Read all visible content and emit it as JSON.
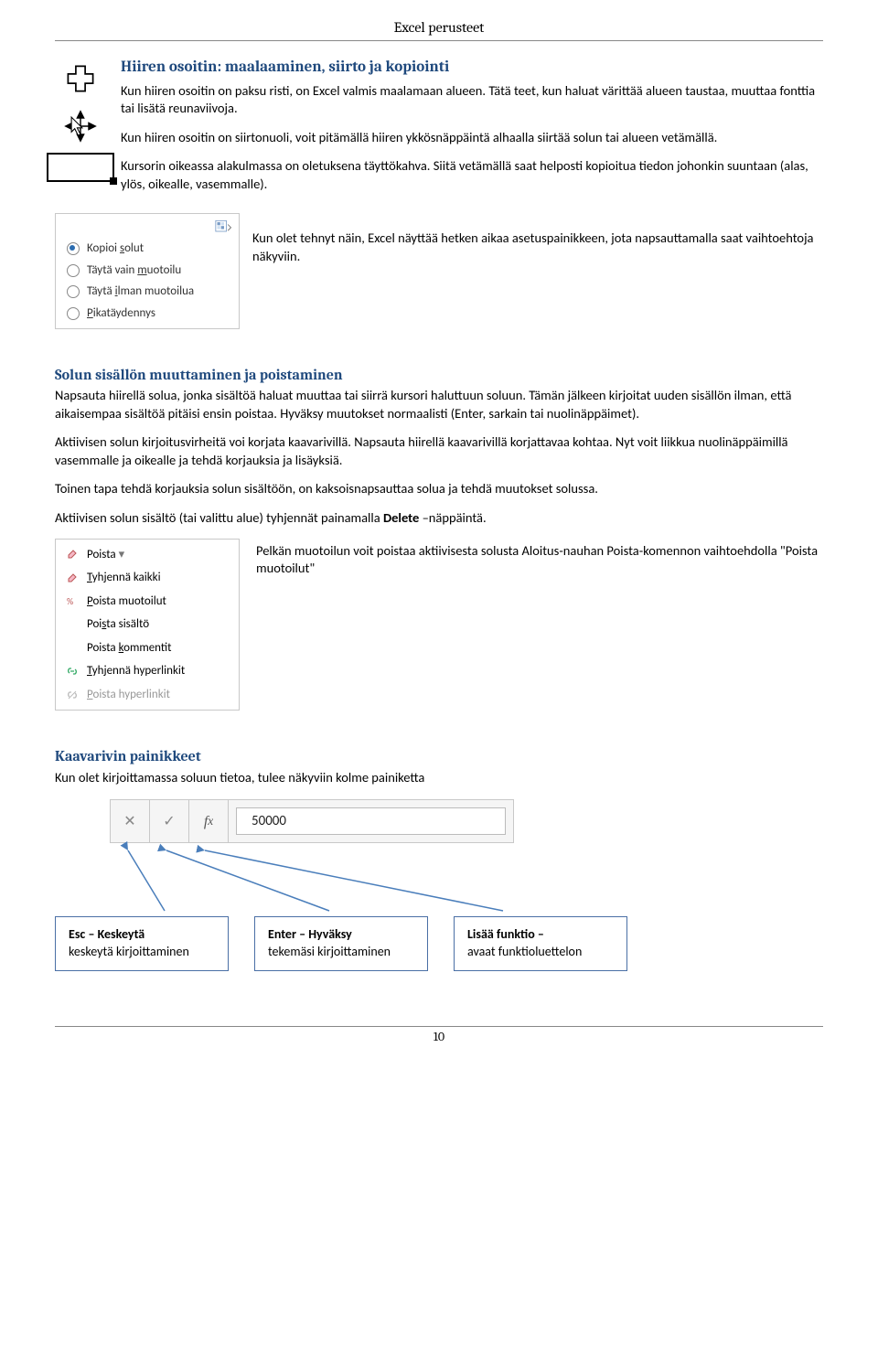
{
  "page_header": "Excel perusteet",
  "page_number": "10",
  "section1": {
    "title": "Hiiren osoitin: maalaaminen, siirto ja kopiointi",
    "p1": "Kun hiiren osoitin on paksu risti, on Excel valmis maalamaan alueen. Tätä teet, kun haluat värittää alueen taustaa, muuttaa fonttia tai lisätä reunaviivoja.",
    "p2": "Kun hiiren osoitin on siirtonuoli, voit pitämällä hiiren ykkösnäppäintä alhaalla siirtää solun tai alueen vetämällä.",
    "p3": "Kursorin oikeassa alakulmassa on oletuksena täyttökahva. Siitä vetämällä saat helposti kopioitua tiedon johonkin suuntaan (alas, ylös, oikealle, vasemmalle)."
  },
  "paste_options": {
    "explain": "Kun olet tehnyt näin, Excel näyttää hetken aikaa asetuspainikkeen, jota napsauttamalla saat vaihtoehtoja näkyviin.",
    "items": [
      {
        "label_pre": "Kopioi ",
        "u": "s",
        "label_post": "olut",
        "selected": true
      },
      {
        "label_pre": "Täytä vain ",
        "u": "m",
        "label_post": "uotoilu",
        "selected": false
      },
      {
        "label_pre": "Täytä ",
        "u": "i",
        "label_post": "lman muotoilua",
        "selected": false
      },
      {
        "label_pre": "",
        "u": "P",
        "label_post": "ikatäydennys",
        "selected": false
      }
    ]
  },
  "section2": {
    "title": "Solun sisällön muuttaminen ja poistaminen",
    "p1": "Napsauta hiirellä solua, jonka sisältöä haluat muuttaa tai siirrä kursori haluttuun soluun. Tämän jälkeen kirjoitat uuden sisällön ilman, että aikaisempaa sisältöä pitäisi ensin poistaa. Hyväksy muutokset normaalisti (Enter, sarkain tai nuolinäppäimet).",
    "p2": "Aktiivisen solun kirjoitusvirheitä voi korjata kaavarivillä. Napsauta hiirellä kaavarivillä korjattavaa kohtaa. Nyt voit liikkua nuolinäppäimillä vasemmalle ja oikealle ja tehdä korjauksia ja lisäyksiä.",
    "p3": "Toinen tapa tehdä korjauksia solun sisältöön, on kaksoisnapsauttaa solua ja tehdä muutokset solussa.",
    "p4a": "Aktiivisen solun sisältö (tai valittu alue) tyhjennät painamalla ",
    "p4_bold": "Delete",
    "p4b": " –näppäintä.",
    "clear_note": "Pelkän muotoilun voit poistaa aktiivisesta solusta Aloitus-nauhan Poista-komennon vaihtoehdolla \"Poista muotoilut\""
  },
  "clear_menu": {
    "header": "Poista",
    "items": [
      {
        "u": "T",
        "rest": "yhjennä kaikki",
        "icon": "eraser"
      },
      {
        "u": "P",
        "rest": "oista muotoilut",
        "icon": "percent"
      },
      {
        "u": "",
        "pre": "Poi",
        "urest": "s",
        "rest2": "ta sisältö",
        "icon": "blank"
      },
      {
        "u": "",
        "pre": "Poista ",
        "urest": "k",
        "rest2": "ommentit",
        "icon": "blank"
      },
      {
        "u": "T",
        "rest": "yhjennä hyperlinkit",
        "icon": "link"
      },
      {
        "u": "P",
        "rest": "oista hyperlinkit",
        "icon": "link-off",
        "disabled": true
      }
    ]
  },
  "section3": {
    "title": "Kaavarivin painikkeet",
    "intro": "Kun olet kirjoittamassa soluun tietoa, tulee näkyviin kolme painiketta",
    "formula_value": "50000",
    "callouts": [
      {
        "bold": "Esc – Keskeytä",
        "rest": "keskeytä kirjoittaminen"
      },
      {
        "bold": "Enter – Hyväksy",
        "rest": "tekemäsi kirjoittaminen"
      },
      {
        "bold": "Lisää funktio –",
        "rest": "avaat funktioluettelon"
      }
    ]
  }
}
